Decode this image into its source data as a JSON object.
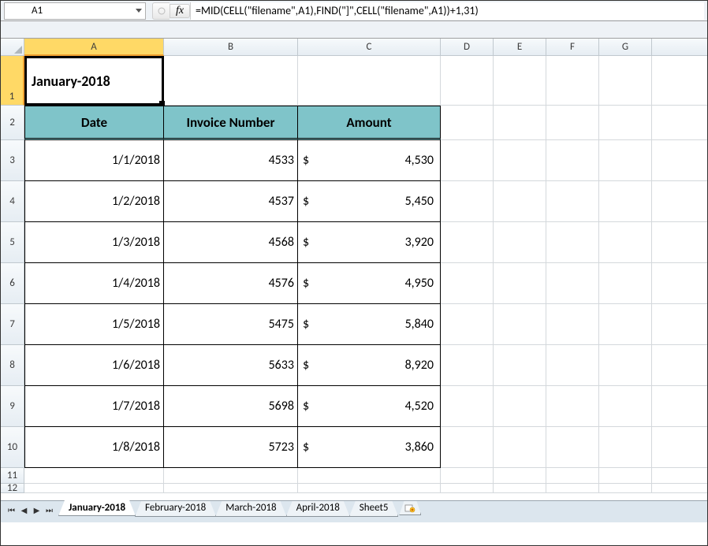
{
  "namebox": {
    "value": "A1"
  },
  "fx": {
    "label": "fx"
  },
  "formula": {
    "value": "=MID(CELL(\"filename\",A1),FIND(\"]\",CELL(\"filename\",A1))+1,31)"
  },
  "columns": [
    "A",
    "B",
    "C",
    "D",
    "E",
    "F",
    "G"
  ],
  "active_cell": {
    "value": "January-2018"
  },
  "headers": {
    "date": "Date",
    "invoice": "Invoice Number",
    "amount": "Amount"
  },
  "currency": "$",
  "chart_data": {
    "type": "table",
    "title": "January-2018",
    "columns": [
      "Date",
      "Invoice Number",
      "Amount"
    ],
    "rows": [
      {
        "date": "1/1/2018",
        "invoice": 4533,
        "amount": 4530
      },
      {
        "date": "1/2/2018",
        "invoice": 4537,
        "amount": 5450
      },
      {
        "date": "1/3/2018",
        "invoice": 4568,
        "amount": 3920
      },
      {
        "date": "1/4/2018",
        "invoice": 4576,
        "amount": 4950
      },
      {
        "date": "1/5/2018",
        "invoice": 5475,
        "amount": 5840
      },
      {
        "date": "1/6/2018",
        "invoice": 5633,
        "amount": 8920
      },
      {
        "date": "1/7/2018",
        "invoice": 5698,
        "amount": 4520
      },
      {
        "date": "1/8/2018",
        "invoice": 5723,
        "amount": 3860
      }
    ]
  },
  "rows": [
    {
      "n": "3",
      "date": "1/1/2018",
      "inv": "4533",
      "amt": "4,530"
    },
    {
      "n": "4",
      "date": "1/2/2018",
      "inv": "4537",
      "amt": "5,450"
    },
    {
      "n": "5",
      "date": "1/3/2018",
      "inv": "4568",
      "amt": "3,920"
    },
    {
      "n": "6",
      "date": "1/4/2018",
      "inv": "4576",
      "amt": "4,950"
    },
    {
      "n": "7",
      "date": "1/5/2018",
      "inv": "5475",
      "amt": "5,840"
    },
    {
      "n": "8",
      "date": "1/6/2018",
      "inv": "5633",
      "amt": "8,920"
    },
    {
      "n": "9",
      "date": "1/7/2018",
      "inv": "5698",
      "amt": "4,520"
    },
    {
      "n": "10",
      "date": "1/8/2018",
      "inv": "5723",
      "amt": "3,860"
    }
  ],
  "extra_rows": [
    "11",
    "12"
  ],
  "tabs": {
    "active": "January-2018",
    "items": [
      "January-2018",
      "February-2018",
      "March-2018",
      "April-2018",
      "Sheet5"
    ]
  }
}
